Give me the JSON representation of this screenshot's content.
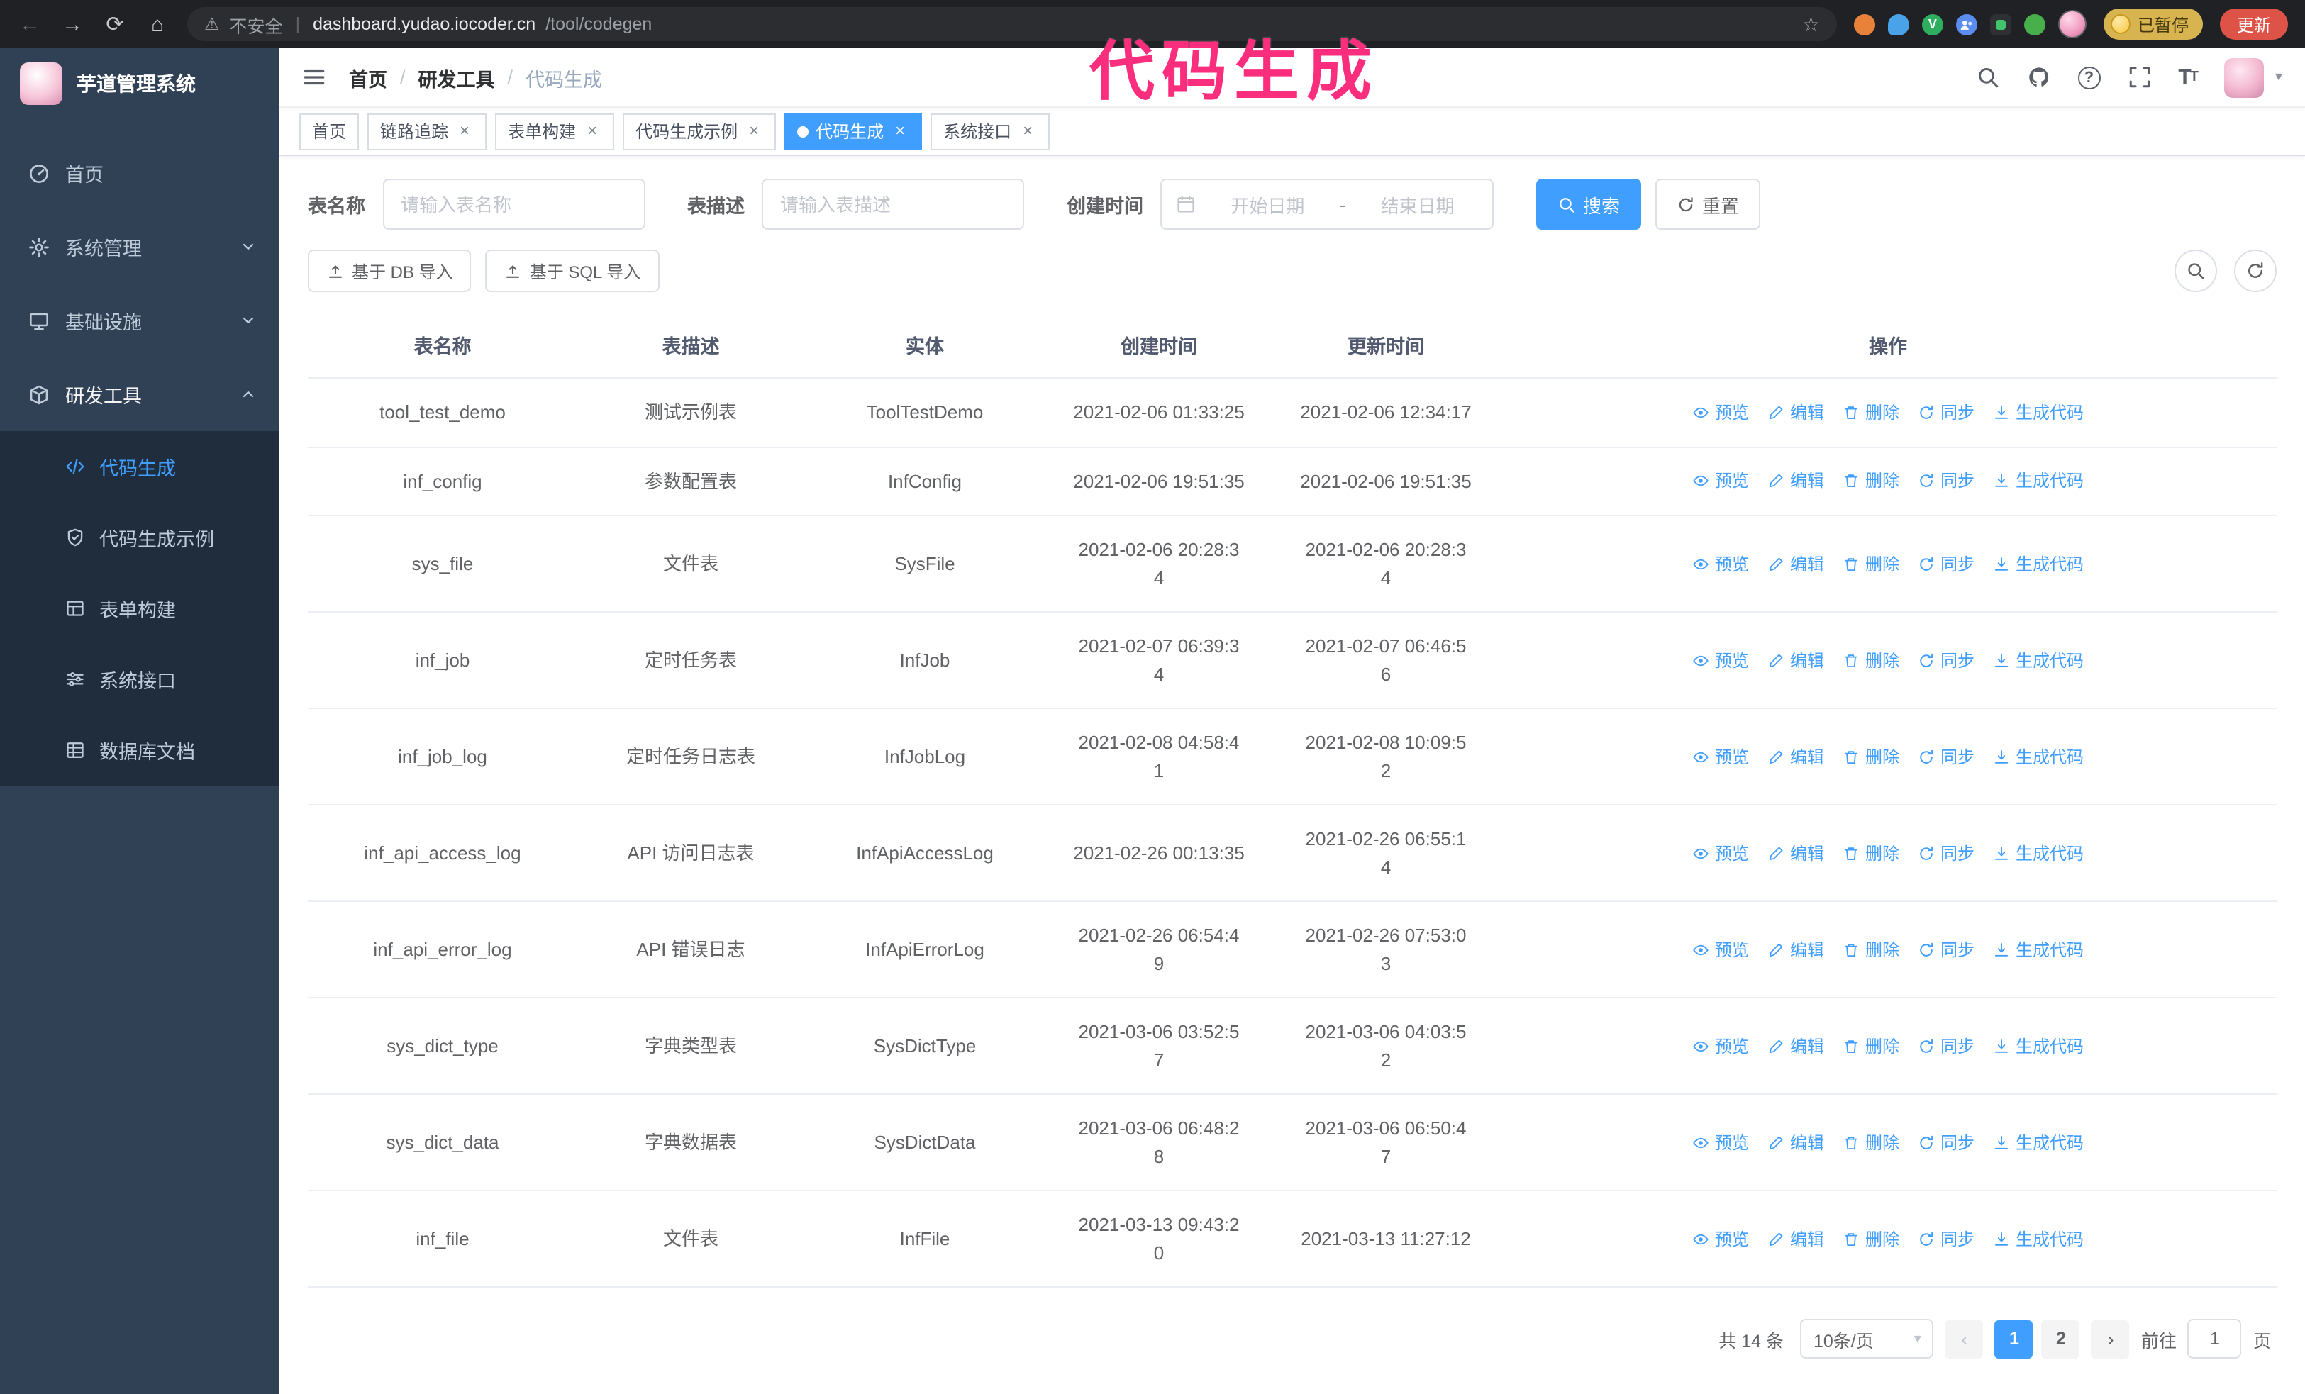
{
  "annotation": {
    "text": "代码生成"
  },
  "colors": {
    "accent": "#409eff",
    "annotation_pink": "#fb2e7e",
    "sidebar_bg": "#304156"
  },
  "browser": {
    "url_security": "不安全",
    "url_host": "dashboard.yudao.iocoder.cn",
    "url_path": "/tool/codegen",
    "paused_badge": "已暂停",
    "update_button": "更新"
  },
  "sidebar": {
    "logo_title": "芋道管理系统",
    "items": [
      {
        "key": "home",
        "icon": "dashboard",
        "label": "首页"
      },
      {
        "key": "system",
        "icon": "gear",
        "label": "系统管理",
        "expandable": true
      },
      {
        "key": "infra",
        "icon": "monitor",
        "label": "基础设施",
        "expandable": true
      },
      {
        "key": "dev-tools",
        "icon": "cube",
        "label": "研发工具",
        "expandable": true,
        "children": [
          {
            "key": "codegen",
            "icon": "code",
            "label": "代码生成",
            "active": true
          },
          {
            "key": "codegen-example",
            "icon": "shield",
            "label": "代码生成示例"
          },
          {
            "key": "form-builder",
            "icon": "form",
            "label": "表单构建"
          },
          {
            "key": "api",
            "icon": "sliders",
            "label": "系统接口"
          },
          {
            "key": "db-doc",
            "icon": "grid",
            "label": "数据库文档"
          }
        ]
      }
    ]
  },
  "navbar": {
    "breadcrumb": [
      "首页",
      "研发工具",
      "代码生成"
    ]
  },
  "tabs": [
    {
      "key": "home",
      "label": "首页",
      "closable": false,
      "active": false
    },
    {
      "key": "trace",
      "label": "链路追踪",
      "closable": true,
      "active": false
    },
    {
      "key": "form-builder",
      "label": "表单构建",
      "closable": true,
      "active": false
    },
    {
      "key": "codegen-example",
      "label": "代码生成示例",
      "closable": true,
      "active": false
    },
    {
      "key": "codegen",
      "label": "代码生成",
      "closable": true,
      "active": true
    },
    {
      "key": "api",
      "label": "系统接口",
      "closable": true,
      "active": false
    }
  ],
  "filters": {
    "table_name_label": "表名称",
    "table_name_placeholder": "请输入表名称",
    "table_desc_label": "表描述",
    "table_desc_placeholder": "请输入表描述",
    "create_time_label": "创建时间",
    "date_start_placeholder": "开始日期",
    "date_separator": "-",
    "date_end_placeholder": "结束日期",
    "search_button": "搜索",
    "reset_button": "重置"
  },
  "toolbar": {
    "import_db": "基于 DB 导入",
    "import_sql": "基于 SQL 导入"
  },
  "table": {
    "columns": [
      "表名称",
      "表描述",
      "实体",
      "创建时间",
      "更新时间",
      "操作"
    ],
    "actions": [
      {
        "key": "preview",
        "icon": "eye",
        "label": "预览"
      },
      {
        "key": "edit",
        "icon": "edit",
        "label": "编辑"
      },
      {
        "key": "delete",
        "icon": "trash",
        "label": "删除"
      },
      {
        "key": "sync",
        "icon": "sync",
        "label": "同步"
      },
      {
        "key": "generate",
        "icon": "download",
        "label": "生成代码"
      }
    ],
    "rows": [
      {
        "name": "tool_test_demo",
        "desc": "测试示例表",
        "entity": "ToolTestDemo",
        "created": "2021-02-06 01:33:25",
        "updated": "2021-02-06 12:34:17"
      },
      {
        "name": "inf_config",
        "desc": "参数配置表",
        "entity": "InfConfig",
        "created": "2021-02-06 19:51:35",
        "updated": "2021-02-06 19:51:35"
      },
      {
        "name": "sys_file",
        "desc": "文件表",
        "entity": "SysFile",
        "created": "2021-02-06 20:28:3\n4",
        "updated": "2021-02-06 20:28:3\n4"
      },
      {
        "name": "inf_job",
        "desc": "定时任务表",
        "entity": "InfJob",
        "created": "2021-02-07 06:39:3\n4",
        "updated": "2021-02-07 06:46:5\n6"
      },
      {
        "name": "inf_job_log",
        "desc": "定时任务日志表",
        "entity": "InfJobLog",
        "created": "2021-02-08 04:58:4\n1",
        "updated": "2021-02-08 10:09:5\n2"
      },
      {
        "name": "inf_api_access_log",
        "desc": "API 访问日志表",
        "entity": "InfApiAccessLog",
        "created": "2021-02-26 00:13:35",
        "updated": "2021-02-26 06:55:1\n4"
      },
      {
        "name": "inf_api_error_log",
        "desc": "API 错误日志",
        "entity": "InfApiErrorLog",
        "created": "2021-02-26 06:54:4\n9",
        "updated": "2021-02-26 07:53:0\n3"
      },
      {
        "name": "sys_dict_type",
        "desc": "字典类型表",
        "entity": "SysDictType",
        "created": "2021-03-06 03:52:5\n7",
        "updated": "2021-03-06 04:03:5\n2"
      },
      {
        "name": "sys_dict_data",
        "desc": "字典数据表",
        "entity": "SysDictData",
        "created": "2021-03-06 06:48:2\n8",
        "updated": "2021-03-06 06:50:4\n7"
      },
      {
        "name": "inf_file",
        "desc": "文件表",
        "entity": "InfFile",
        "created": "2021-03-13 09:43:2\n0",
        "updated": "2021-03-13 11:27:12"
      }
    ]
  },
  "pagination": {
    "total_text": "共 14 条",
    "page_size": "10条/页",
    "pages": [
      "1",
      "2"
    ],
    "active_page": "1",
    "goto_label": "前往",
    "goto_value": "1",
    "goto_suffix": "页"
  }
}
